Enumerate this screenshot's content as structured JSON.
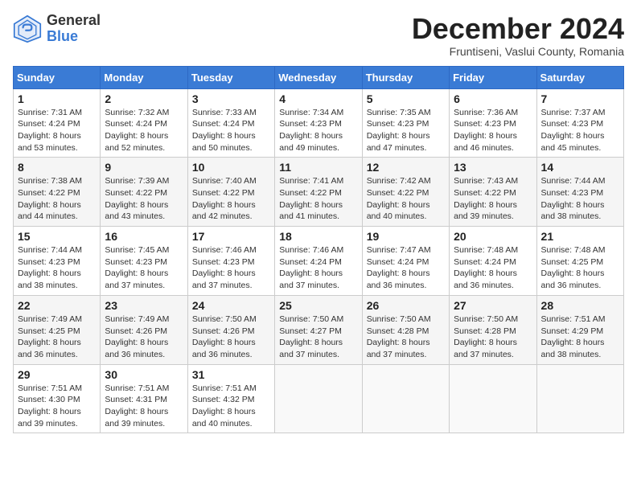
{
  "header": {
    "logo_general": "General",
    "logo_blue": "Blue",
    "month_title": "December 2024",
    "subtitle": "Fruntiseni, Vaslui County, Romania"
  },
  "weekdays": [
    "Sunday",
    "Monday",
    "Tuesday",
    "Wednesday",
    "Thursday",
    "Friday",
    "Saturday"
  ],
  "weeks": [
    [
      {
        "day": "1",
        "sunrise": "7:31 AM",
        "sunset": "4:24 PM",
        "daylight": "8 hours and 53 minutes."
      },
      {
        "day": "2",
        "sunrise": "7:32 AM",
        "sunset": "4:24 PM",
        "daylight": "8 hours and 52 minutes."
      },
      {
        "day": "3",
        "sunrise": "7:33 AM",
        "sunset": "4:24 PM",
        "daylight": "8 hours and 50 minutes."
      },
      {
        "day": "4",
        "sunrise": "7:34 AM",
        "sunset": "4:23 PM",
        "daylight": "8 hours and 49 minutes."
      },
      {
        "day": "5",
        "sunrise": "7:35 AM",
        "sunset": "4:23 PM",
        "daylight": "8 hours and 47 minutes."
      },
      {
        "day": "6",
        "sunrise": "7:36 AM",
        "sunset": "4:23 PM",
        "daylight": "8 hours and 46 minutes."
      },
      {
        "day": "7",
        "sunrise": "7:37 AM",
        "sunset": "4:23 PM",
        "daylight": "8 hours and 45 minutes."
      }
    ],
    [
      {
        "day": "8",
        "sunrise": "7:38 AM",
        "sunset": "4:22 PM",
        "daylight": "8 hours and 44 minutes."
      },
      {
        "day": "9",
        "sunrise": "7:39 AM",
        "sunset": "4:22 PM",
        "daylight": "8 hours and 43 minutes."
      },
      {
        "day": "10",
        "sunrise": "7:40 AM",
        "sunset": "4:22 PM",
        "daylight": "8 hours and 42 minutes."
      },
      {
        "day": "11",
        "sunrise": "7:41 AM",
        "sunset": "4:22 PM",
        "daylight": "8 hours and 41 minutes."
      },
      {
        "day": "12",
        "sunrise": "7:42 AM",
        "sunset": "4:22 PM",
        "daylight": "8 hours and 40 minutes."
      },
      {
        "day": "13",
        "sunrise": "7:43 AM",
        "sunset": "4:22 PM",
        "daylight": "8 hours and 39 minutes."
      },
      {
        "day": "14",
        "sunrise": "7:44 AM",
        "sunset": "4:23 PM",
        "daylight": "8 hours and 38 minutes."
      }
    ],
    [
      {
        "day": "15",
        "sunrise": "7:44 AM",
        "sunset": "4:23 PM",
        "daylight": "8 hours and 38 minutes."
      },
      {
        "day": "16",
        "sunrise": "7:45 AM",
        "sunset": "4:23 PM",
        "daylight": "8 hours and 37 minutes."
      },
      {
        "day": "17",
        "sunrise": "7:46 AM",
        "sunset": "4:23 PM",
        "daylight": "8 hours and 37 minutes."
      },
      {
        "day": "18",
        "sunrise": "7:46 AM",
        "sunset": "4:24 PM",
        "daylight": "8 hours and 37 minutes."
      },
      {
        "day": "19",
        "sunrise": "7:47 AM",
        "sunset": "4:24 PM",
        "daylight": "8 hours and 36 minutes."
      },
      {
        "day": "20",
        "sunrise": "7:48 AM",
        "sunset": "4:24 PM",
        "daylight": "8 hours and 36 minutes."
      },
      {
        "day": "21",
        "sunrise": "7:48 AM",
        "sunset": "4:25 PM",
        "daylight": "8 hours and 36 minutes."
      }
    ],
    [
      {
        "day": "22",
        "sunrise": "7:49 AM",
        "sunset": "4:25 PM",
        "daylight": "8 hours and 36 minutes."
      },
      {
        "day": "23",
        "sunrise": "7:49 AM",
        "sunset": "4:26 PM",
        "daylight": "8 hours and 36 minutes."
      },
      {
        "day": "24",
        "sunrise": "7:50 AM",
        "sunset": "4:26 PM",
        "daylight": "8 hours and 36 minutes."
      },
      {
        "day": "25",
        "sunrise": "7:50 AM",
        "sunset": "4:27 PM",
        "daylight": "8 hours and 37 minutes."
      },
      {
        "day": "26",
        "sunrise": "7:50 AM",
        "sunset": "4:28 PM",
        "daylight": "8 hours and 37 minutes."
      },
      {
        "day": "27",
        "sunrise": "7:50 AM",
        "sunset": "4:28 PM",
        "daylight": "8 hours and 37 minutes."
      },
      {
        "day": "28",
        "sunrise": "7:51 AM",
        "sunset": "4:29 PM",
        "daylight": "8 hours and 38 minutes."
      }
    ],
    [
      {
        "day": "29",
        "sunrise": "7:51 AM",
        "sunset": "4:30 PM",
        "daylight": "8 hours and 39 minutes."
      },
      {
        "day": "30",
        "sunrise": "7:51 AM",
        "sunset": "4:31 PM",
        "daylight": "8 hours and 39 minutes."
      },
      {
        "day": "31",
        "sunrise": "7:51 AM",
        "sunset": "4:32 PM",
        "daylight": "8 hours and 40 minutes."
      },
      null,
      null,
      null,
      null
    ]
  ]
}
